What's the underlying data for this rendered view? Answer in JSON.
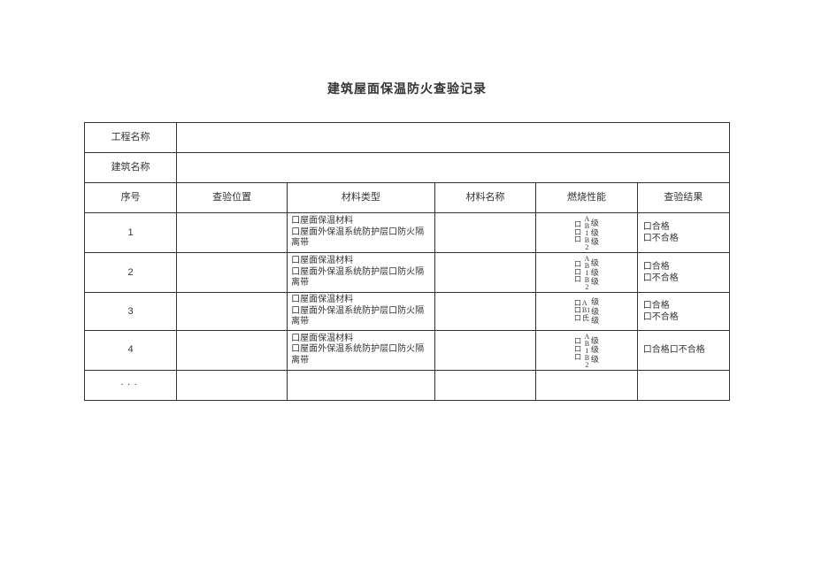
{
  "title": "建筑屋面保温防火查验记录",
  "form_labels": {
    "project_name": "工程名称",
    "building_name": "建筑名称"
  },
  "columns": {
    "seq": "序号",
    "location": "查验位置",
    "material_type": "材料类型",
    "material_name": "材料名称",
    "performance": "燃烧性能",
    "result": "查验结果"
  },
  "checkbox_glyph": "口",
  "material_type_options": {
    "opt1": "口屋面保温材料",
    "opt2": "口屋面外保温系统防护层口防火隔离带"
  },
  "perf_levels": {
    "a": "A",
    "b1": "B1",
    "b2": "B2",
    "grade": "级"
  },
  "perf_levels_alt": {
    "a": "A",
    "b1": "B1",
    "c": "氏",
    "grade": "级"
  },
  "perf_levels_combined": {
    "vert": "AB1B2",
    "grade": "级"
  },
  "result_options": {
    "pass": "口合格",
    "fail": "口不合格",
    "inline": "口合格口不合格"
  },
  "rows": [
    {
      "seq": "1"
    },
    {
      "seq": "2"
    },
    {
      "seq": "3"
    },
    {
      "seq": "4"
    }
  ],
  "ellipsis": "···"
}
